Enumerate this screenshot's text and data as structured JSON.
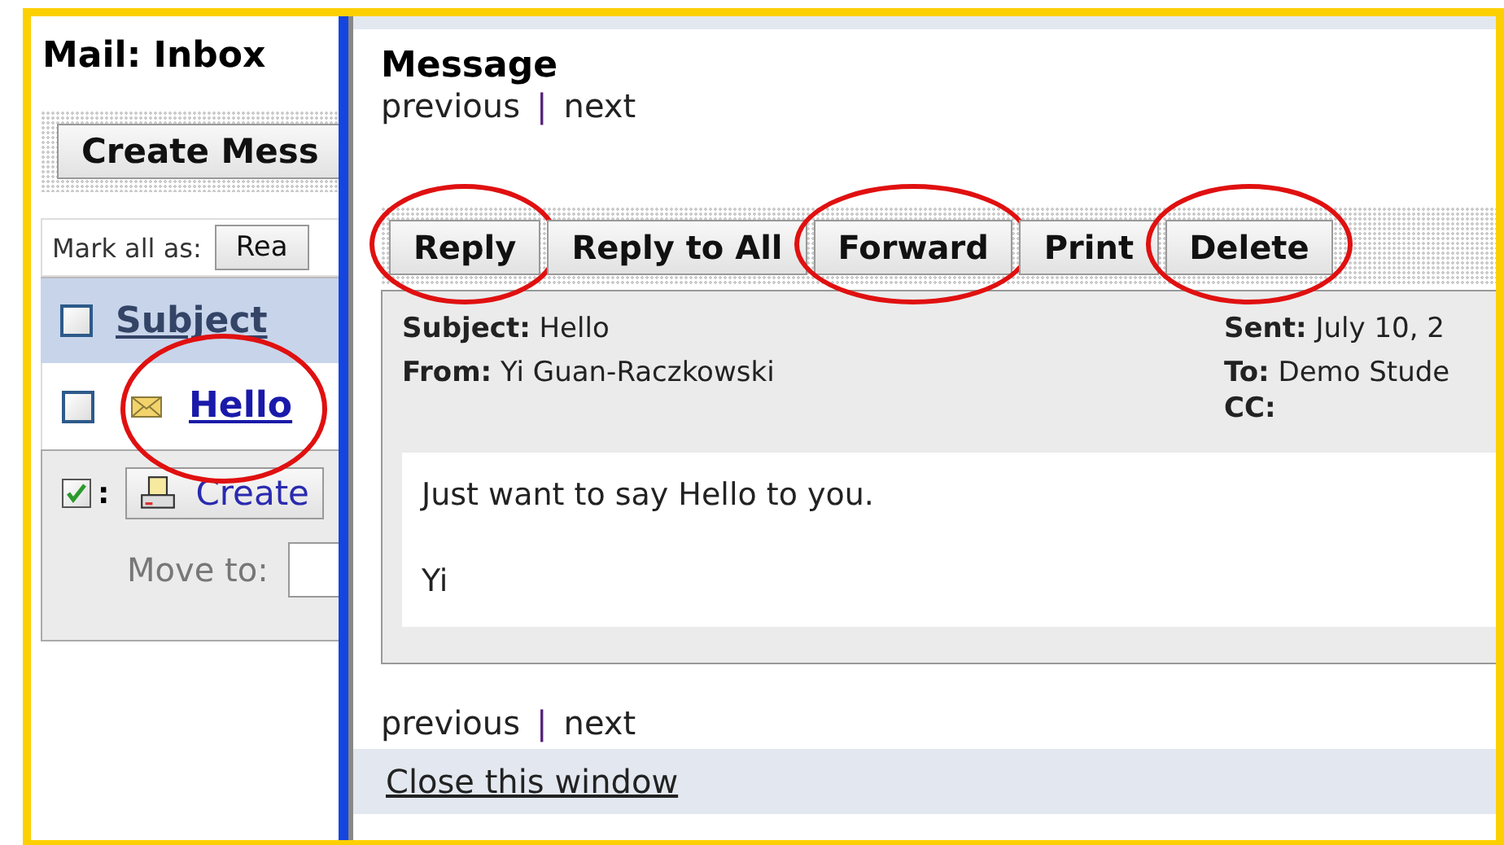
{
  "left_panel": {
    "title": "Mail: Inbox",
    "create_button": "Create Mess",
    "mark_all_label": "Mark all as:",
    "mark_all_button": "Rea",
    "header": {
      "label": "Subject",
      "checked": false
    },
    "messages": [
      {
        "subject": "Hello",
        "checked": false,
        "unread": true,
        "circled": true
      }
    ],
    "actions": {
      "checked": true,
      "colon": ":",
      "button": "Create",
      "move_label": "Move to:"
    }
  },
  "message_window": {
    "title": "Message",
    "nav_top": {
      "previous": "previous",
      "separator": "|",
      "next": "next"
    },
    "buttons": [
      {
        "label": "Reply",
        "circled": true
      },
      {
        "label": "Reply to All",
        "circled": false
      },
      {
        "label": "Forward",
        "circled": true
      },
      {
        "label": "Print",
        "circled": false
      },
      {
        "label": "Delete",
        "circled": true
      }
    ],
    "fields_left": [
      {
        "label": "Subject:",
        "value": "Hello"
      },
      {
        "label": "From:",
        "value": "Yi Guan-Raczkowski"
      }
    ],
    "fields_right": [
      {
        "label": "Sent:",
        "value": "July 10, 2"
      },
      {
        "label": "To:",
        "value": "Demo Stude"
      },
      {
        "label": "CC:"
      }
    ],
    "body": [
      "Just want to say Hello to you.",
      "Yi"
    ],
    "nav_bottom": {
      "previous": "previous",
      "separator": "|",
      "next": "next"
    },
    "close_link": "Close this window"
  }
}
